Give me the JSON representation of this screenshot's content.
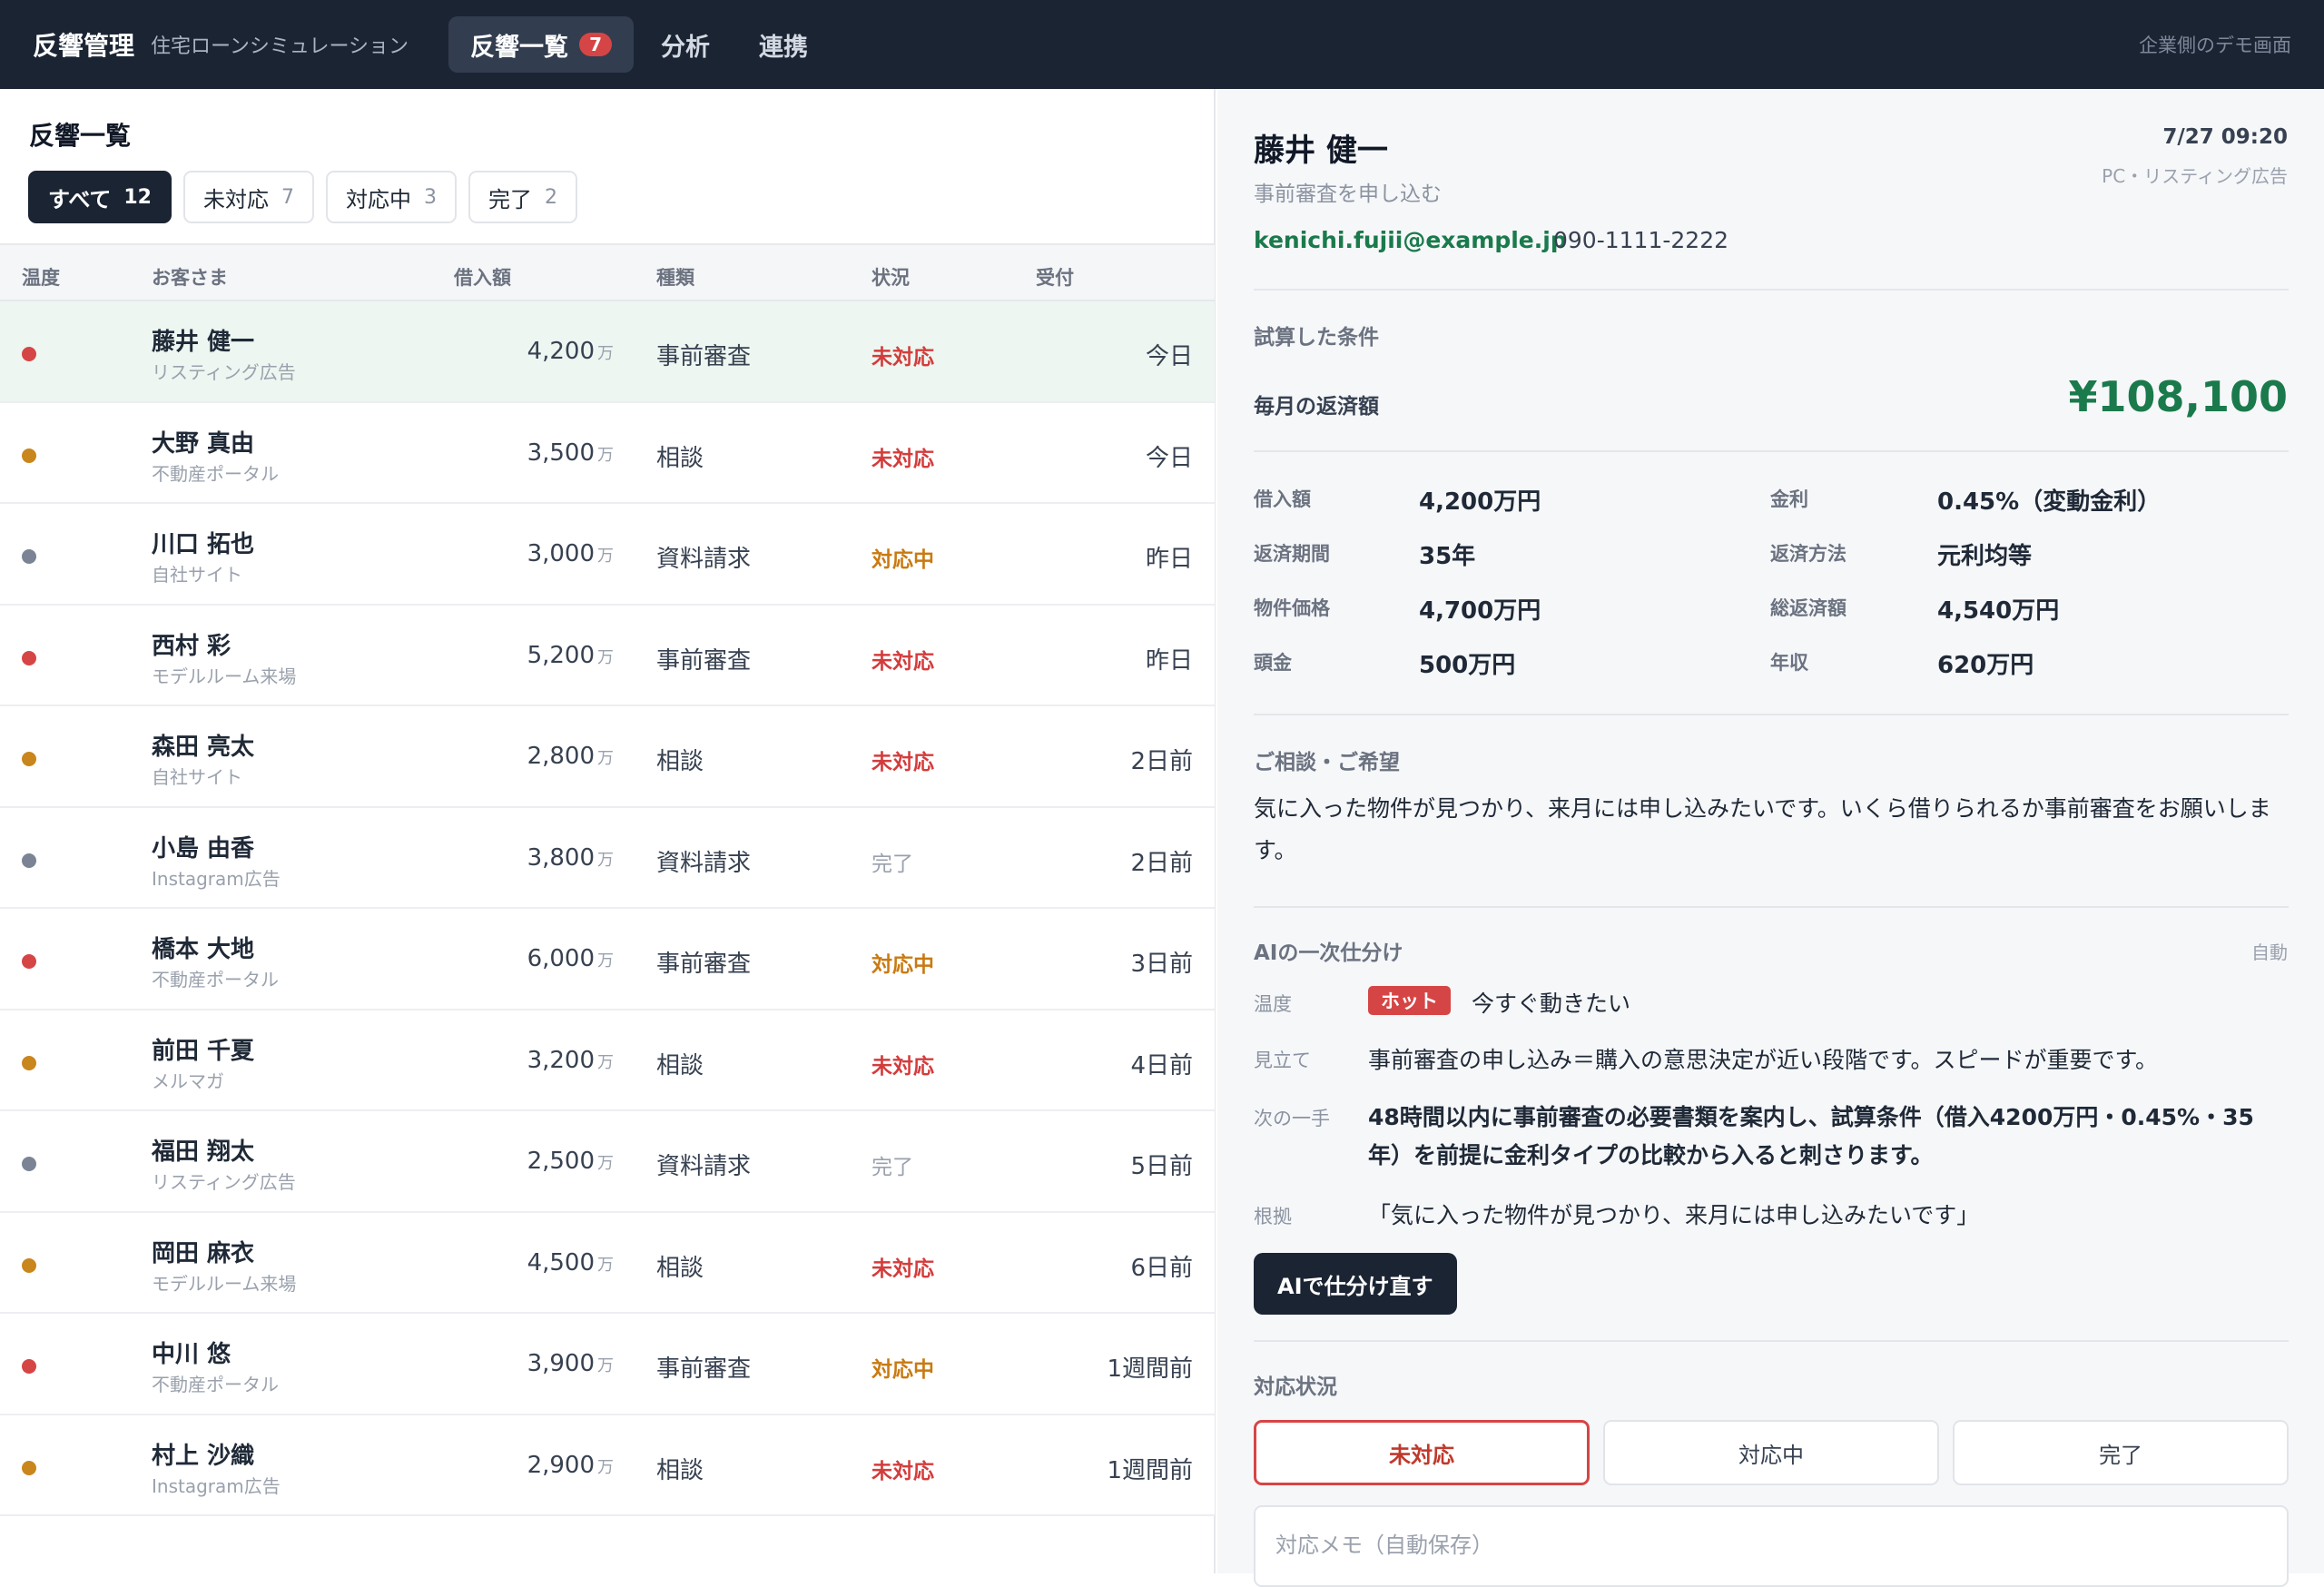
{
  "header": {
    "brand": "反響管理",
    "subtitle": "住宅ローンシミュレーション",
    "nav": [
      {
        "label": "反響一覧",
        "badge": "7",
        "active": true
      },
      {
        "label": "分析"
      },
      {
        "label": "連携"
      }
    ],
    "right_note": "企業側のデモ画面"
  },
  "list": {
    "title": "反響一覧",
    "filters": [
      {
        "label": "すべて",
        "count": "12",
        "active": true
      },
      {
        "label": "未対応",
        "count": "7"
      },
      {
        "label": "対応中",
        "count": "3"
      },
      {
        "label": "完了",
        "count": "2"
      }
    ],
    "columns": {
      "temp": "温度",
      "customer": "お客さま",
      "amount": "借入額",
      "kind": "種類",
      "status": "状況",
      "received": "受付"
    },
    "amount_unit": "万",
    "rows": [
      {
        "temp": "hot",
        "name": "藤井 健一",
        "source": "リスティング広告",
        "amount": "4,200",
        "kind": "事前審査",
        "status": "未対応",
        "received": "今日",
        "selected": true
      },
      {
        "temp": "warm",
        "name": "大野 真由",
        "source": "不動産ポータル",
        "amount": "3,500",
        "kind": "相談",
        "status": "未対応",
        "received": "今日"
      },
      {
        "temp": "cold",
        "name": "川口 拓也",
        "source": "自社サイト",
        "amount": "3,000",
        "kind": "資料請求",
        "status": "対応中",
        "received": "昨日"
      },
      {
        "temp": "hot",
        "name": "西村 彩",
        "source": "モデルルーム来場",
        "amount": "5,200",
        "kind": "事前審査",
        "status": "未対応",
        "received": "昨日"
      },
      {
        "temp": "warm",
        "name": "森田 亮太",
        "source": "自社サイト",
        "amount": "2,800",
        "kind": "相談",
        "status": "未対応",
        "received": "2日前"
      },
      {
        "temp": "cold",
        "name": "小島 由香",
        "source": "Instagram広告",
        "amount": "3,800",
        "kind": "資料請求",
        "status": "完了",
        "received": "2日前"
      },
      {
        "temp": "hot",
        "name": "橋本 大地",
        "source": "不動産ポータル",
        "amount": "6,000",
        "kind": "事前審査",
        "status": "対応中",
        "received": "3日前"
      },
      {
        "temp": "warm",
        "name": "前田 千夏",
        "source": "メルマガ",
        "amount": "3,200",
        "kind": "相談",
        "status": "未対応",
        "received": "4日前"
      },
      {
        "temp": "cold",
        "name": "福田 翔太",
        "source": "リスティング広告",
        "amount": "2,500",
        "kind": "資料請求",
        "status": "完了",
        "received": "5日前"
      },
      {
        "temp": "warm",
        "name": "岡田 麻衣",
        "source": "モデルルーム来場",
        "amount": "4,500",
        "kind": "相談",
        "status": "未対応",
        "received": "6日前"
      },
      {
        "temp": "hot",
        "name": "中川 悠",
        "source": "不動産ポータル",
        "amount": "3,900",
        "kind": "事前審査",
        "status": "対応中",
        "received": "1週間前"
      },
      {
        "temp": "warm",
        "name": "村上 沙織",
        "source": "Instagram広告",
        "amount": "2,900",
        "kind": "相談",
        "status": "未対応",
        "received": "1週間前"
      }
    ]
  },
  "detail": {
    "name": "藤井 健一",
    "action": "事前審査を申し込む",
    "time": "7/27 09:20",
    "channel": "PC・リスティング広告",
    "email": "kenichi.fujii@example.jp",
    "phone": "090-1111-2222",
    "conditions_title": "試算した条件",
    "monthly_label": "毎月の返済額",
    "monthly_value": "¥108,100",
    "conditions": [
      {
        "label": "借入額",
        "value": "4,200万円"
      },
      {
        "label": "金利",
        "value": "0.45%（変動金利）"
      },
      {
        "label": "返済期間",
        "value": "35年"
      },
      {
        "label": "返済方法",
        "value": "元利均等"
      },
      {
        "label": "物件価格",
        "value": "4,700万円"
      },
      {
        "label": "総返済額",
        "value": "4,540万円"
      },
      {
        "label": "頭金",
        "value": "500万円"
      },
      {
        "label": "年収",
        "value": "620万円"
      }
    ],
    "consult_title": "ご相談・ご希望",
    "consult_text": "気に入った物件が見つかり、来月には申し込みたいです。いくら借りられるか事前審査をお願いします。",
    "ai": {
      "title": "AIの一次仕分け",
      "auto": "自動",
      "temp_label": "温度",
      "temp_badge": "ホット",
      "temp_text": "今すぐ動きたい",
      "view_label": "見立て",
      "view_text": "事前審査の申し込み＝購入の意思決定が近い段階です。スピードが重要です。",
      "next_label": "次の一手",
      "next_text": "48時間以内に事前審査の必要書類を案内し、試算条件（借入4200万円・0.45%・35年）を前提に金利タイプの比較から入ると刺さります。",
      "basis_label": "根拠",
      "basis_text": "「気に入った物件が見つかり、来月には申し込みたいです」",
      "button": "AIで仕分け直す"
    },
    "status_title": "対応状況",
    "status_buttons": [
      "未対応",
      "対応中",
      "完了"
    ],
    "memo_placeholder": "対応メモ（自動保存）"
  },
  "colors": {
    "hot": "#d64545",
    "warm": "#c9861c",
    "cold": "#7b8494",
    "status_pending": "#d43c3c",
    "status_progress": "#c97a10",
    "status_done": "#9aa1ad",
    "accent_green": "#1a7a4c"
  }
}
